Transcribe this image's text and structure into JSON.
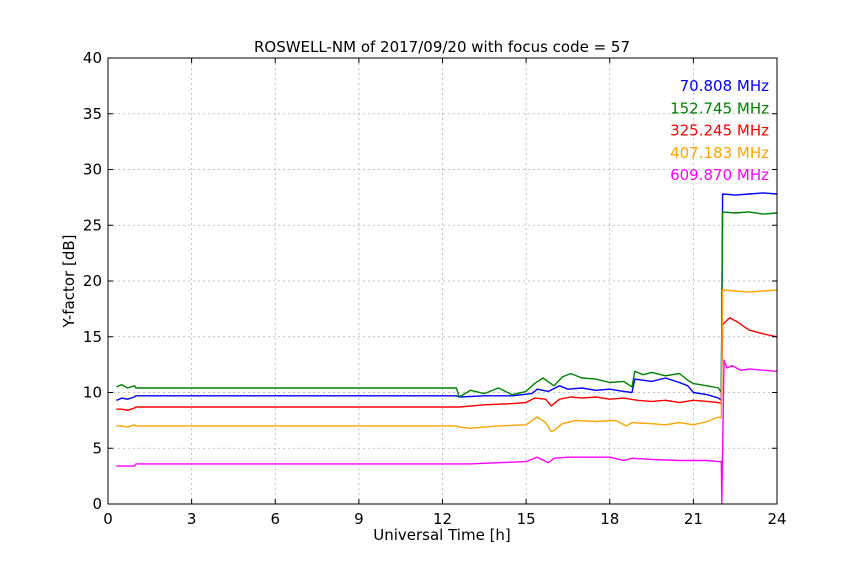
{
  "chart_data": {
    "type": "line",
    "title": "ROSWELL-NM of 2017/09/20 with focus code = 57",
    "xlabel": "Universal Time [h]",
    "ylabel": "Y-factor [dB]",
    "xlim": [
      0,
      24
    ],
    "ylim": [
      0,
      40
    ],
    "xticks": [
      0,
      3,
      6,
      9,
      12,
      15,
      18,
      21,
      24
    ],
    "yticks": [
      0,
      5,
      10,
      15,
      20,
      25,
      30,
      35,
      40
    ],
    "grid": true,
    "legend_position": "top-right",
    "series": [
      {
        "name": "70.808 MHz",
        "color": "#0000ff",
        "x": [
          0.3,
          0.5,
          0.7,
          0.95,
          1.0,
          5.0,
          10.0,
          12.5,
          12.6,
          13.5,
          14.5,
          15.2,
          15.4,
          15.8,
          16.2,
          16.5,
          17.0,
          17.5,
          18.0,
          18.5,
          18.8,
          18.9,
          19.5,
          20.0,
          20.5,
          20.8,
          21.0,
          21.5,
          21.9,
          22.0,
          22.05,
          22.5,
          23.0,
          23.5,
          24.0
        ],
        "y": [
          9.3,
          9.5,
          9.4,
          9.6,
          9.7,
          9.7,
          9.7,
          9.7,
          9.6,
          9.7,
          9.7,
          9.9,
          10.3,
          10.1,
          10.6,
          10.3,
          10.4,
          10.2,
          10.3,
          10.1,
          10.0,
          11.2,
          11.0,
          11.3,
          10.9,
          10.6,
          10.0,
          9.8,
          9.5,
          9.3,
          27.8,
          27.7,
          27.8,
          27.9,
          27.8
        ]
      },
      {
        "name": "152.745 MHz",
        "color": "#008000",
        "x": [
          0.3,
          0.5,
          0.7,
          0.95,
          1.0,
          5.0,
          10.0,
          12.5,
          12.6,
          13.0,
          13.5,
          14.0,
          14.5,
          15.0,
          15.3,
          15.6,
          16.0,
          16.3,
          16.6,
          17.0,
          17.5,
          18.0,
          18.5,
          18.8,
          18.9,
          19.2,
          19.5,
          20.0,
          20.5,
          20.8,
          21.0,
          21.5,
          21.9,
          22.0,
          22.05,
          22.5,
          23.0,
          23.5,
          24.0
        ],
        "y": [
          10.5,
          10.7,
          10.4,
          10.6,
          10.4,
          10.4,
          10.4,
          10.4,
          9.6,
          10.2,
          9.9,
          10.4,
          9.8,
          10.1,
          10.8,
          11.3,
          10.6,
          11.4,
          11.7,
          11.3,
          11.2,
          10.9,
          11.0,
          10.5,
          11.9,
          11.6,
          11.8,
          11.5,
          11.7,
          11.1,
          10.8,
          10.6,
          10.4,
          10.0,
          26.2,
          26.1,
          26.2,
          26.0,
          26.1
        ]
      },
      {
        "name": "325.245 MHz",
        "color": "#ff0000",
        "x": [
          0.3,
          0.5,
          0.7,
          0.95,
          1.0,
          5.0,
          10.0,
          12.5,
          12.6,
          13.5,
          14.5,
          15.0,
          15.3,
          15.7,
          15.9,
          16.2,
          16.6,
          17.0,
          17.5,
          18.0,
          18.5,
          19.0,
          19.5,
          20.0,
          20.5,
          21.0,
          21.5,
          21.9,
          22.0,
          22.05,
          22.3,
          22.6,
          23.0,
          23.3,
          23.6,
          24.0
        ],
        "y": [
          8.5,
          8.5,
          8.4,
          8.6,
          8.7,
          8.7,
          8.7,
          8.7,
          8.7,
          8.9,
          9.0,
          9.1,
          9.5,
          9.4,
          8.8,
          9.4,
          9.6,
          9.5,
          9.6,
          9.4,
          9.5,
          9.3,
          9.2,
          9.3,
          9.1,
          9.3,
          9.2,
          9.1,
          9.0,
          16.1,
          16.7,
          16.3,
          15.6,
          15.4,
          15.2,
          15.0
        ]
      },
      {
        "name": "407.183 MHz",
        "color": "#ffa500",
        "x": [
          0.3,
          0.5,
          0.7,
          0.95,
          1.0,
          5.0,
          10.0,
          12.5,
          12.6,
          13.0,
          14.0,
          15.0,
          15.4,
          15.7,
          15.9,
          16.0,
          16.3,
          16.8,
          17.5,
          18.2,
          18.6,
          18.8,
          19.5,
          20.0,
          20.5,
          21.0,
          21.5,
          21.9,
          22.0,
          22.05,
          22.5,
          23.0,
          23.5,
          24.0
        ],
        "y": [
          7.0,
          7.0,
          6.9,
          7.1,
          7.0,
          7.0,
          7.0,
          7.0,
          6.9,
          6.8,
          7.0,
          7.1,
          7.8,
          7.3,
          6.5,
          6.6,
          7.2,
          7.5,
          7.4,
          7.5,
          7.0,
          7.3,
          7.2,
          7.1,
          7.3,
          7.1,
          7.4,
          7.8,
          7.7,
          19.2,
          19.1,
          19.0,
          19.1,
          19.2
        ]
      },
      {
        "name": "609.870 MHz",
        "color": "#ff00ff",
        "x": [
          0.3,
          0.5,
          0.7,
          0.95,
          1.0,
          5.0,
          10.0,
          12.5,
          12.6,
          13.0,
          14.0,
          15.0,
          15.4,
          15.8,
          16.0,
          16.5,
          17.0,
          18.0,
          18.5,
          18.8,
          19.5,
          20.5,
          21.5,
          21.9,
          22.0,
          22.02,
          22.1,
          22.2,
          22.4,
          22.7,
          23.0,
          23.5,
          24.0
        ],
        "y": [
          3.4,
          3.4,
          3.4,
          3.4,
          3.6,
          3.6,
          3.6,
          3.6,
          3.6,
          3.6,
          3.7,
          3.8,
          4.2,
          3.7,
          4.1,
          4.2,
          4.2,
          4.2,
          3.9,
          4.1,
          4.0,
          3.9,
          3.9,
          3.8,
          3.8,
          0.0,
          12.9,
          12.2,
          12.4,
          12.0,
          12.1,
          12.0,
          11.9
        ]
      }
    ]
  }
}
